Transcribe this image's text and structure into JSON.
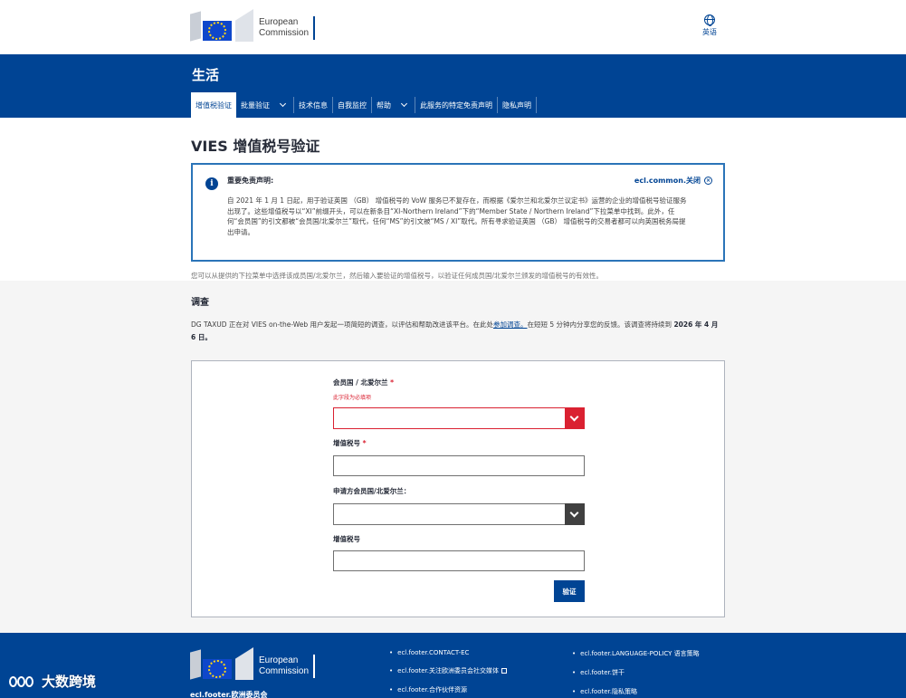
{
  "header": {
    "logo_line1": "European",
    "logo_line2": "Commission",
    "lang_label": "英语"
  },
  "band": {
    "site_title": "生活",
    "nav": [
      {
        "label": "增值税验证"
      },
      {
        "label": "批量验证"
      },
      {
        "label": "技术信息"
      },
      {
        "label": "自我监控"
      },
      {
        "label": "帮助"
      },
      {
        "label": "此服务的特定免责声明"
      },
      {
        "label": "隐私声明"
      }
    ]
  },
  "main": {
    "page_title": "VIES 增值税号验证",
    "notice": {
      "title": "重要免责声明:",
      "close_label": "ecl.common.关闭",
      "body": "自 2021 年 1 月 1 日起，用于验证英国 （GB） 增值税号的 VoW 服务已不复存在，而根据《爱尔兰和北爱尔兰议定书》运营的企业的增值税号验证服务出现了。这些增值税号以“XI”前缀开头，可以在新条目“XI-Northern Ireland”下的“Member State / Northern Ireland”下拉菜单中找到。此外，任何“会员国”的引文都被“会员国/北爱尔兰”取代，任何“MS”的引文被“MS / XI”取代。所有寻求验证英国 （GB） 增值税号的交易者都可以向英国税务局提出申请。"
    },
    "intro": "您可以从提供的下拉菜单中选择该成员国/北爱尔兰，然后输入要验证的增值税号，以验证任何成员国/北爱尔兰颁发的增值税号的有效性。",
    "survey": {
      "title": "调查",
      "text_before": "DG TAXUD 正在对 VIES on-the-Web 用户发起一项简短的调查，以评估和帮助改进该平台。在此处",
      "link": "参加调查。",
      "text_after": "在短短 5 分钟内分享您的反馈。该调查将持续到 ",
      "date": "2026 年 4 月 6 日。"
    },
    "form": {
      "member_state_label": "会员国 / 北爱尔兰",
      "required_mark": "*",
      "error_text": "此字段为必填项",
      "vat_label": "增值税号",
      "requester_label": "申请方会员国/北爱尔兰：",
      "requester_vat_label": "增值税号",
      "verify_button": "验证"
    }
  },
  "footer": {
    "logo_line1": "European",
    "logo_line2": "Commission",
    "ec_label": "ecl.footer.欧洲委员会",
    "col1": [
      "ecl.footer.CONTACT-EC",
      "ecl.footer.关注欧洲委员会社交媒体",
      "ecl.footer.合作伙伴资源"
    ],
    "col2": [
      "ecl.footer.LANGUAGE-POLICY 语言策略",
      "ecl.footer.饼干",
      "ecl.footer.隐私策略"
    ]
  },
  "watermark": {
    "text": "大数跨境"
  },
  "colors": {
    "brand_blue": "#004494",
    "notice_border": "#2b74b8",
    "error_red": "#da2131",
    "dark_select": "#404040"
  }
}
